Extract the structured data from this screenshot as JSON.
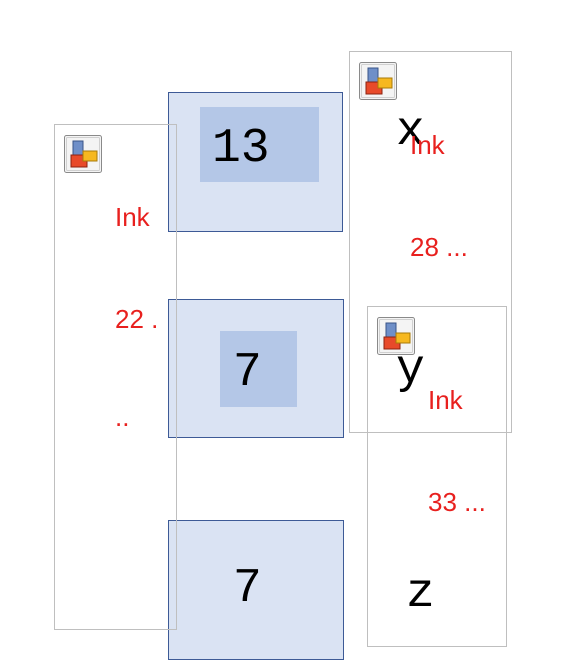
{
  "cells": [
    {
      "value": "13"
    },
    {
      "value": "7"
    },
    {
      "value": "7"
    }
  ],
  "variables": [
    "x",
    "y",
    "z"
  ],
  "ink_annotations": [
    {
      "title": "Ink",
      "line2": "22 .",
      "line3": ".."
    },
    {
      "title": "Ink",
      "line2": "28 ..."
    },
    {
      "title": "Ink",
      "line2": "33 ..."
    }
  ],
  "icon": "ink-annotation-icon",
  "colors": {
    "cell_fill": "#dae3f3",
    "cell_highlight": "#b4c7e7",
    "cell_border": "#3d5a96",
    "ink_text": "#e8201e",
    "annotation_border": "#bfbfbf"
  }
}
